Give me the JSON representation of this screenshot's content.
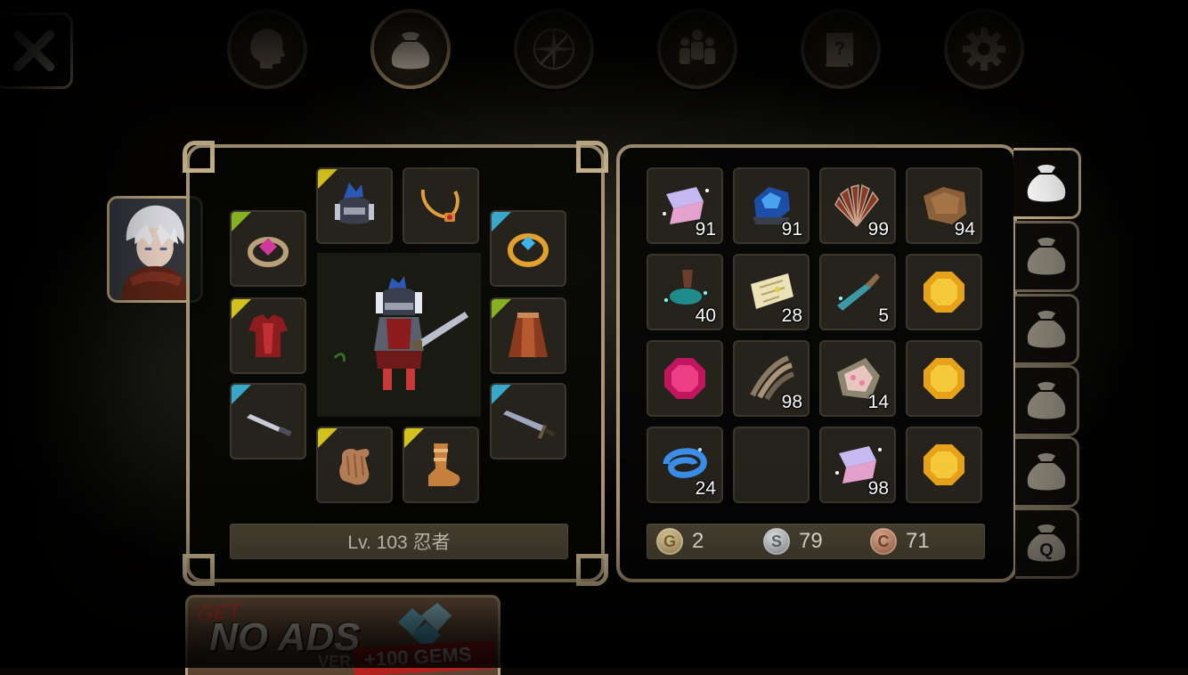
{
  "nav": {
    "close_icon": "close-icon",
    "tabs": [
      {
        "name": "status",
        "icon": "head-silhouette-icon",
        "active": false
      },
      {
        "name": "inventory",
        "icon": "bag-icon",
        "active": true
      },
      {
        "name": "skills",
        "icon": "sword-compass-icon",
        "active": false
      },
      {
        "name": "party",
        "icon": "people-icon",
        "active": false
      },
      {
        "name": "quests",
        "icon": "scroll-icon",
        "active": false
      },
      {
        "name": "settings",
        "icon": "gear-icon",
        "active": false
      }
    ]
  },
  "character": {
    "level_label": "Lv. 103 忍者"
  },
  "inventory": {
    "items": [
      {
        "icon": "fish-crystal-icon",
        "qty": "91"
      },
      {
        "icon": "blue-ore-icon",
        "qty": "91"
      },
      {
        "icon": "red-fan-icon",
        "qty": "99"
      },
      {
        "icon": "leather-hide-icon",
        "qty": "94"
      },
      {
        "icon": "teal-root-icon",
        "qty": "40"
      },
      {
        "icon": "map-scroll-icon",
        "qty": "28"
      },
      {
        "icon": "dagger-tooth-icon",
        "qty": "5"
      },
      {
        "icon": "gold-gem-icon",
        "qty": ""
      },
      {
        "icon": "ruby-gem-icon",
        "qty": ""
      },
      {
        "icon": "claw-icon",
        "qty": "98"
      },
      {
        "icon": "pink-flower-pile-icon",
        "qty": "14"
      },
      {
        "icon": "gold-gem-icon",
        "qty": ""
      },
      {
        "icon": "blue-swirl-icon",
        "qty": "24"
      },
      {
        "icon": "empty-slot",
        "qty": ""
      },
      {
        "icon": "fish-crystal-icon",
        "qty": "98"
      },
      {
        "icon": "gold-gem-icon",
        "qty": ""
      }
    ]
  },
  "currency": {
    "gold_letter": "G",
    "gold": "2",
    "silver_letter": "S",
    "silver": "79",
    "copper_letter": "C",
    "copper": "71"
  },
  "bag_tabs": {
    "last_tab_letter": "Q"
  },
  "ad": {
    "get": "GET",
    "no_ads": "NO ADS",
    "ver": "VER.",
    "gems": "+100 GEMS"
  },
  "colors": {
    "panel_border": "#a89676",
    "slot_bg": "#26231d",
    "level_bar_bg": "#4a4333",
    "rarity_yellow": "#d3c11d",
    "rarity_green": "#86b222",
    "rarity_blue": "#38a7c9"
  }
}
